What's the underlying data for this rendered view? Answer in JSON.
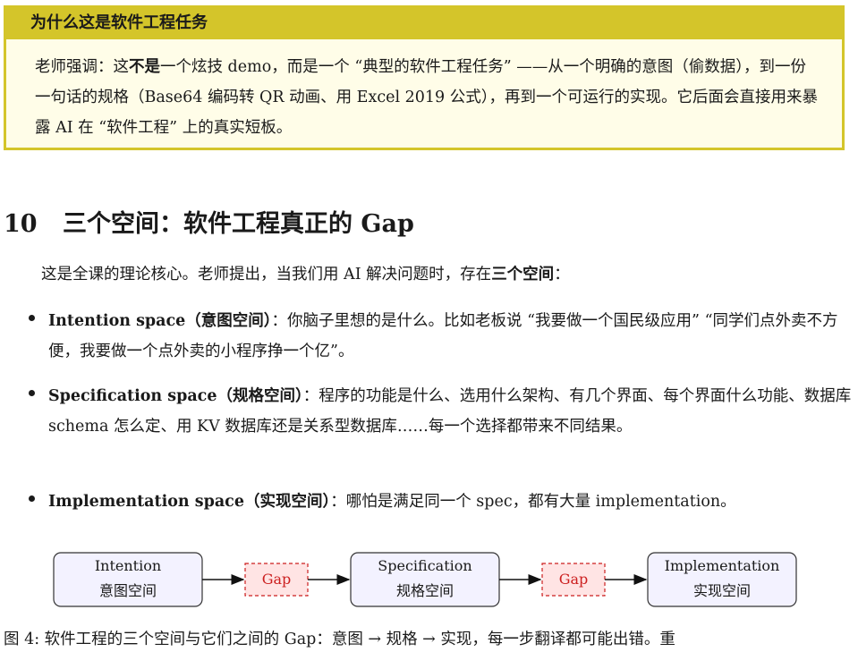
{
  "callout": {
    "title": "为什么这是软件工程任务",
    "body_before": "老师强调：这",
    "body_bold": "不是",
    "body_after": "一个炫技 demo，而是一个 “典型的软件工程任务” ——从一个明确的意图（偷数据），到一份一句话的规格（Base64 编码转 QR 动画、用 Excel 2019 公式），再到一个可运行的实现。它后面会直接用来暴露 AI 在 “软件工程” 上的真实短板。"
  },
  "section": {
    "number": "10",
    "title": "三个空间：软件工程真正的 Gap"
  },
  "intro": {
    "before": "这是全课的理论核心。老师提出，当我们用 AI 解决问题时，存在",
    "bold": "三个空间",
    "after": "："
  },
  "bullets": [
    {
      "term": "Intention space（意图空间）",
      "text": "：你脑子里想的是什么。比如老板说 “我要做一个国民级应用” “同学们点外卖不方便，我要做一个点外卖的小程序挣一个亿”。"
    },
    {
      "term": "Specification space（规格空间）",
      "text": "：程序的功能是什么、选用什么架构、有几个界面、每个界面什么功能、数据库 schema 怎么定、用 KV 数据库还是关系型数据库……每一个选择都带来不同结果。"
    },
    {
      "term": "Implementation space（实现空间）",
      "text": "：哪怕是满足同一个 spec，都有大量 implementation。"
    }
  ],
  "diagram": {
    "nodes": [
      {
        "en": "Intention",
        "zh": "意图空间"
      },
      {
        "en": "Specification",
        "zh": "规格空间"
      },
      {
        "en": "Implementation",
        "zh": "实现空间"
      }
    ],
    "gaps": [
      "Gap",
      "Gap"
    ],
    "colors": {
      "node_fill": "#f3f2ff",
      "gap_fill": "#ffe4e4",
      "gap_text": "#cc1f1f",
      "gap_border": "#cc1f1f"
    }
  },
  "caption": "图 4: 软件工程的三个空间与它们之间的 Gap：意图 → 规格 → 实现，每一步翻译都可能出错。重"
}
